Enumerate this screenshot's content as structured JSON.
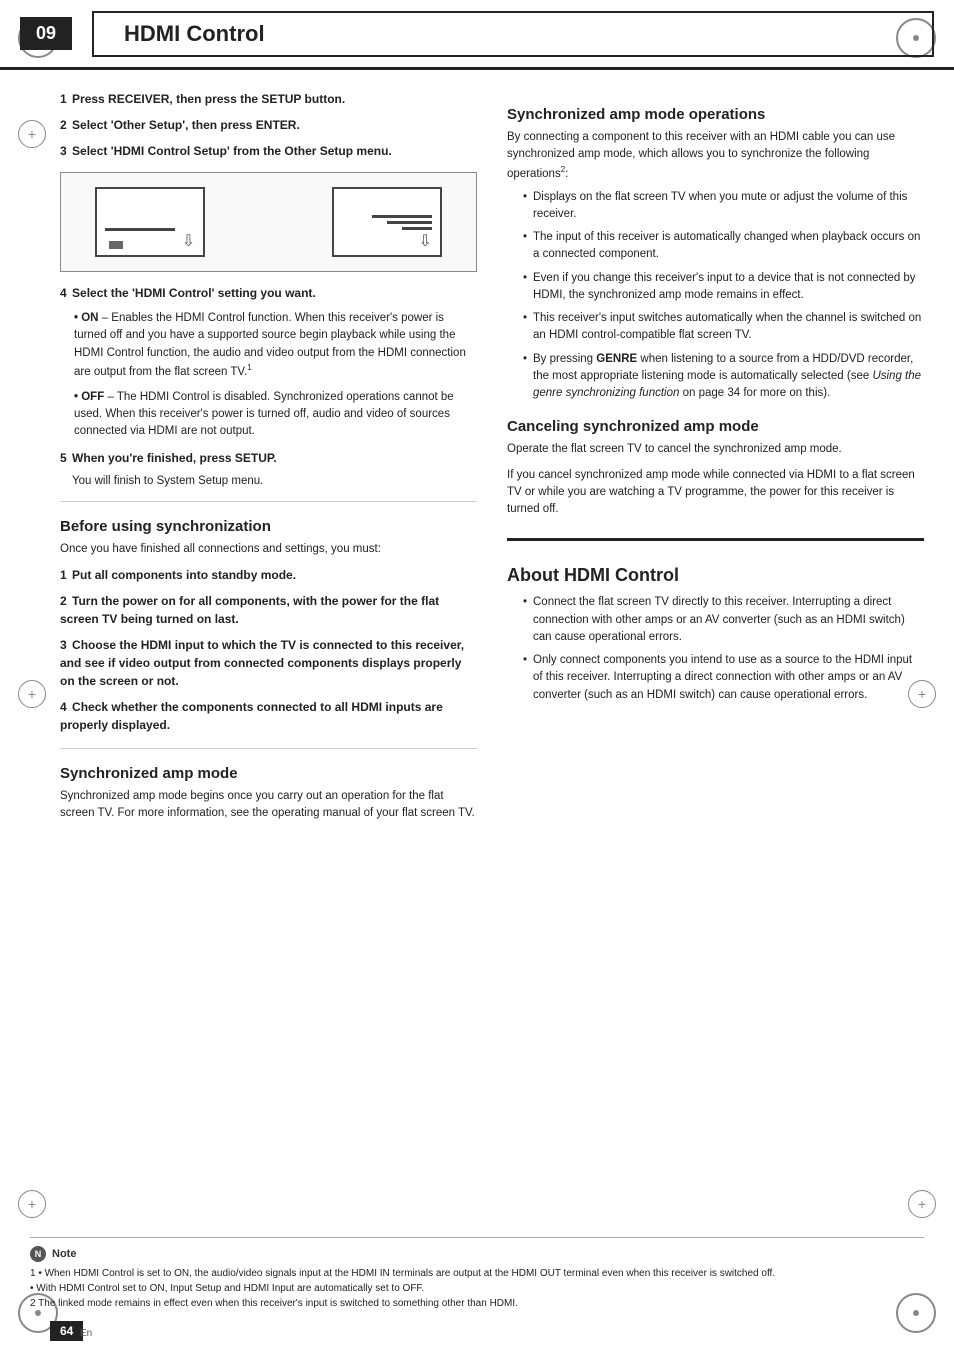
{
  "page": {
    "chapter": "09",
    "title": "HDMI Control",
    "page_number": "64",
    "page_lang": "En"
  },
  "header": {
    "chapter_label": "09",
    "title_label": "HDMI Control"
  },
  "left_column": {
    "steps": [
      {
        "num": "1",
        "text": "Press RECEIVER, then press the SETUP button.",
        "bold": true
      },
      {
        "num": "2",
        "text": "Select 'Other Setup', then press ENTER.",
        "bold": true
      },
      {
        "num": "3",
        "text": "Select 'HDMI Control Setup' from the Other Setup menu.",
        "bold": true
      }
    ],
    "step4_label": "4",
    "step4_text": "Select the 'HDMI Control' setting you want.",
    "on_label": "ON",
    "on_text": "– Enables the HDMI Control function. When this receiver's power is turned off and you have a supported source begin playback while using the HDMI Control function, the audio and video output from the HDMI connection are output from the flat screen TV.",
    "on_sup": "1",
    "off_label": "OFF",
    "off_text": "– The HDMI Control is disabled. Synchronized operations cannot be used. When this receiver's power is turned off, audio and video of sources connected via HDMI are not output.",
    "step5_label": "5",
    "step5_text": "When you're finished, press SETUP.",
    "step5_sub": "You will finish to System Setup menu.",
    "before_sync_title": "Before using synchronization",
    "before_sync_intro": "Once you have finished all connections and settings, you must:",
    "before_sync_steps": [
      {
        "num": "1",
        "text": "Put all components into standby mode.",
        "bold": true
      },
      {
        "num": "2",
        "text": "Turn the power on for all components, with the power for the flat screen TV being turned on last.",
        "bold": true
      },
      {
        "num": "3",
        "text": "Choose the HDMI input to which the TV is connected to this receiver, and see if video output from connected components displays properly on the screen or not.",
        "bold": true
      },
      {
        "num": "4",
        "text": "Check whether the components connected to all HDMI inputs are properly displayed.",
        "bold": true
      }
    ],
    "sync_amp_title": "Synchronized amp mode",
    "sync_amp_intro": "Synchronized amp mode begins once you carry out an operation for the flat screen TV. For more information, see the operating manual of your flat screen TV."
  },
  "right_column": {
    "sync_amp_ops_title": "Synchronized amp mode operations",
    "sync_amp_ops_intro": "By connecting a component to this receiver with an HDMI cable you can use synchronized amp mode, which allows you to synchronize the following operations",
    "sync_amp_ops_sup": "2",
    "sync_amp_ops_bullets": [
      "Displays on the flat screen TV when you mute or adjust the volume of this receiver.",
      "The input of this receiver is automatically changed when playback occurs on a connected component.",
      "Even if you change this receiver's input to a device that is not connected by HDMI, the synchronized amp mode remains in effect.",
      "This receiver's input switches automatically when the channel is switched on an HDMI control-compatible flat screen TV.",
      "By pressing GENRE when listening to a source from a HDD/DVD recorder, the most appropriate listening mode is automatically selected (see Using the genre synchronizing function on page 34 for more on this)."
    ],
    "cancel_sync_title": "Canceling synchronized amp mode",
    "cancel_sync_text1": "Operate the flat screen TV to cancel the synchronized amp mode.",
    "cancel_sync_text2": "If you cancel synchronized amp mode while connected via HDMI to a flat screen TV or while you are watching a TV programme, the power for this receiver is turned off.",
    "about_hdmi_title": "About HDMI Control",
    "about_hdmi_bullets": [
      "Connect the flat screen TV directly to this receiver. Interrupting a direct connection with other amps or an AV converter (such as an HDMI switch) can cause operational errors.",
      "Only connect components you intend to use as a source to the HDMI input of this receiver. Interrupting a direct connection with other amps or an AV converter (such as an HDMI switch) can cause operational errors."
    ]
  },
  "footer": {
    "note_label": "Note",
    "note_icon_text": "N",
    "footnotes": [
      "1  • When HDMI Control is set to ON, the audio/video signals input at the HDMI IN terminals are output at the HDMI OUT terminal even when this receiver is switched off.",
      "   • With HDMI Control set to ON, Input Setup and HDMI Input are automatically set to OFF.",
      "2  The linked mode remains in effect even when this receiver's input is switched to something other than HDMI."
    ]
  }
}
